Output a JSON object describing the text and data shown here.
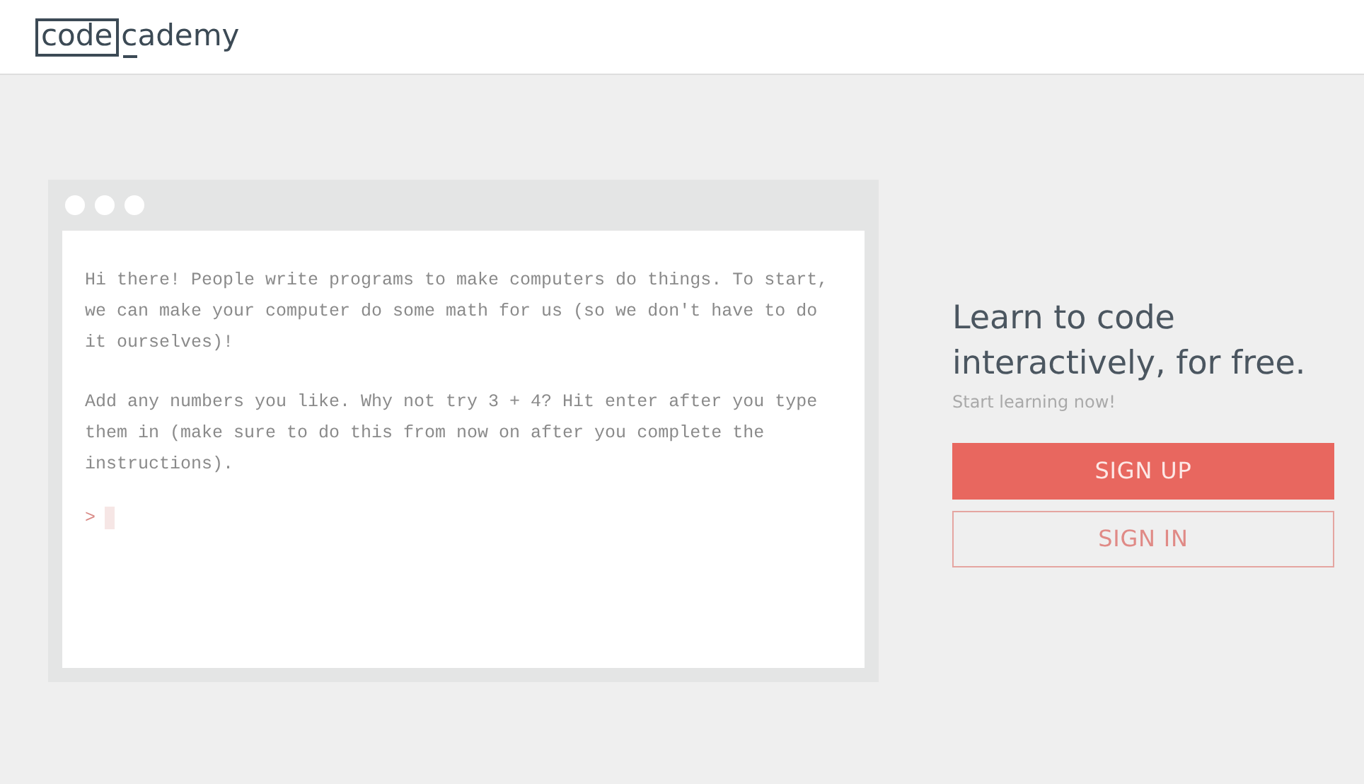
{
  "header": {
    "logo": {
      "boxed": "code",
      "rest": "cademy"
    }
  },
  "terminal": {
    "paragraphs": [
      "Hi there! People write programs to make computers do things. To start, we can make your computer do some math for us (so we don't have to do it ourselves)!",
      "Add any numbers you like. Why not try 3 + 4? Hit enter after you type them in (make sure to do this from now on after you complete the instructions)."
    ],
    "prompt": ">"
  },
  "hero": {
    "title": "Learn to code interactively, for free.",
    "subtitle": "Start learning now!",
    "buttons": [
      {
        "kind": "primary",
        "label": "SIGN UP"
      },
      {
        "kind": "secondary",
        "label": "SIGN IN"
      }
    ]
  }
}
